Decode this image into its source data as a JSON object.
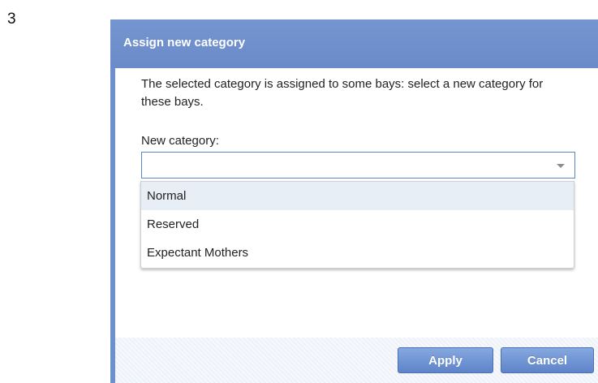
{
  "step_number": "3",
  "dialog": {
    "title": "Assign new category",
    "message": "The selected category is assigned to some bays: select a new category for these bays.",
    "field_label": "New category:",
    "select_value": "",
    "dropdown_options": [
      "Normal",
      "Reserved",
      "Expectant Mothers"
    ],
    "highlighted_option": "Normal",
    "buttons": {
      "apply": "Apply",
      "cancel": "Cancel"
    }
  },
  "colors": {
    "header": "#6d8fcc",
    "footer": "#edf1f8",
    "button": "#6d8fcc",
    "option_highlight": "#e8eef5",
    "select_border": "#5b86c9"
  }
}
